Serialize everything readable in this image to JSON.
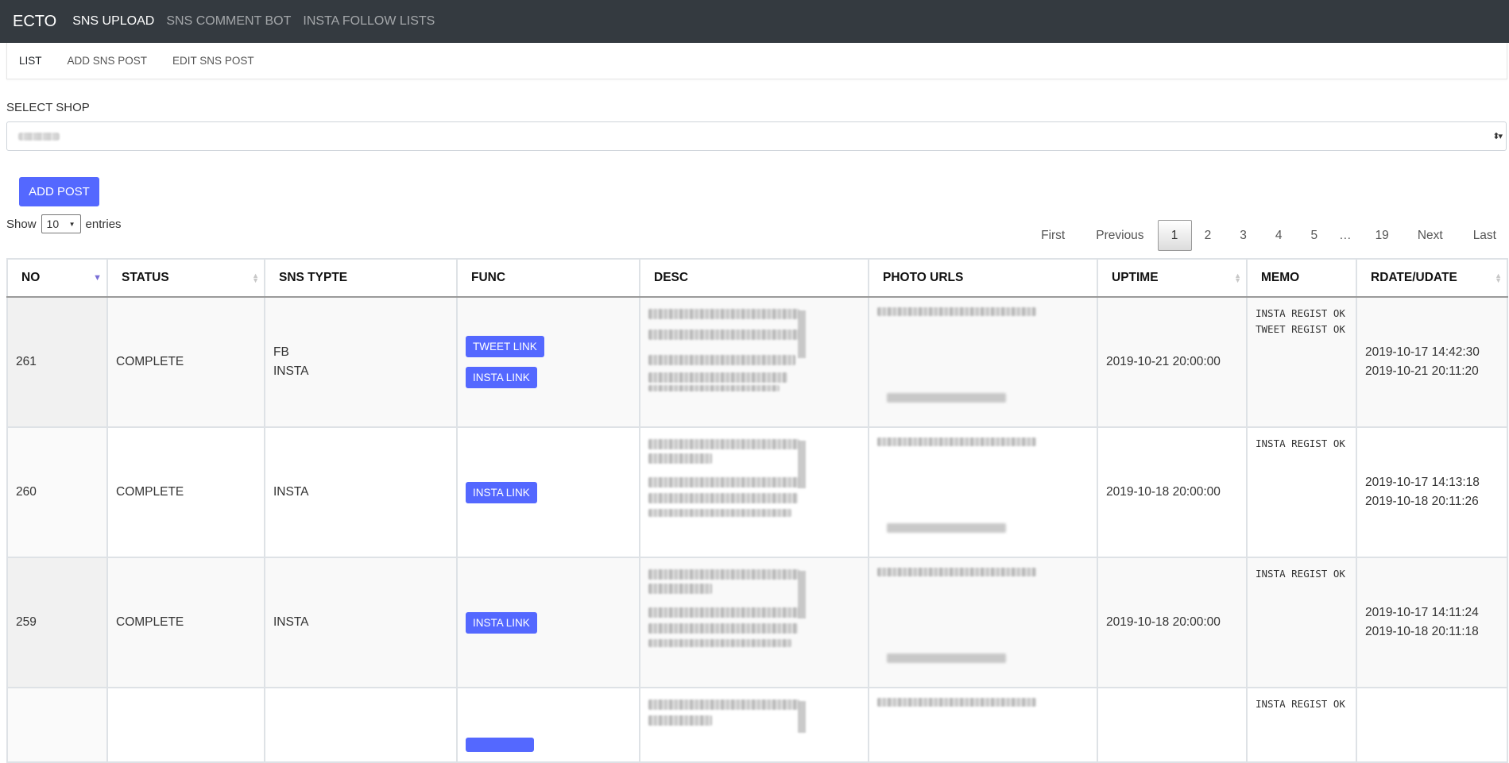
{
  "nav": {
    "brand": "ECTO",
    "links": [
      "SNS UPLOAD",
      "SNS COMMENT BOT",
      "INSTA FOLLOW LISTS"
    ]
  },
  "subtabs": [
    "LIST",
    "ADD SNS POST",
    "EDIT SNS POST"
  ],
  "shop": {
    "label": "SELECT SHOP",
    "arrows": "⬍▾"
  },
  "add_post_label": "ADD POST",
  "entries": {
    "prefix": "Show",
    "value": "10",
    "suffix": "entries"
  },
  "pagination": [
    "First",
    "Previous",
    "1",
    "2",
    "3",
    "4",
    "5",
    "…",
    "19",
    "Next",
    "Last"
  ],
  "table": {
    "headers": [
      "NO",
      "STATUS",
      "SNS TYPTE",
      "FUNC",
      "DESC",
      "PHOTO URLS",
      "UPTIME",
      "MEMO",
      "RDATE/UDATE"
    ],
    "rows": [
      {
        "no": "261",
        "status": "COMPLETE",
        "sns": [
          "FB",
          "INSTA"
        ],
        "buttons": [
          "TWEET LINK",
          "INSTA LINK"
        ],
        "uptime": "2019-10-21 20:00:00",
        "memo": [
          "INSTA REGIST OK",
          "TWEET REGIST OK"
        ],
        "rdate": "2019-10-17 14:42:30",
        "udate": "2019-10-21 20:11:20"
      },
      {
        "no": "260",
        "status": "COMPLETE",
        "sns": [
          "INSTA"
        ],
        "buttons": [
          "INSTA LINK"
        ],
        "uptime": "2019-10-18 20:00:00",
        "memo": [
          "INSTA REGIST OK"
        ],
        "rdate": "2019-10-17 14:13:18",
        "udate": "2019-10-18 20:11:26"
      },
      {
        "no": "259",
        "status": "COMPLETE",
        "sns": [
          "INSTA"
        ],
        "buttons": [
          "INSTA LINK"
        ],
        "uptime": "2019-10-18 20:00:00",
        "memo": [
          "INSTA REGIST OK"
        ],
        "rdate": "2019-10-17 14:11:24",
        "udate": "2019-10-18 20:11:18"
      },
      {
        "memo": [
          "INSTA REGIST OK"
        ]
      }
    ]
  },
  "colors": {
    "navbar": "#343a40",
    "accent": "#5468ff"
  }
}
